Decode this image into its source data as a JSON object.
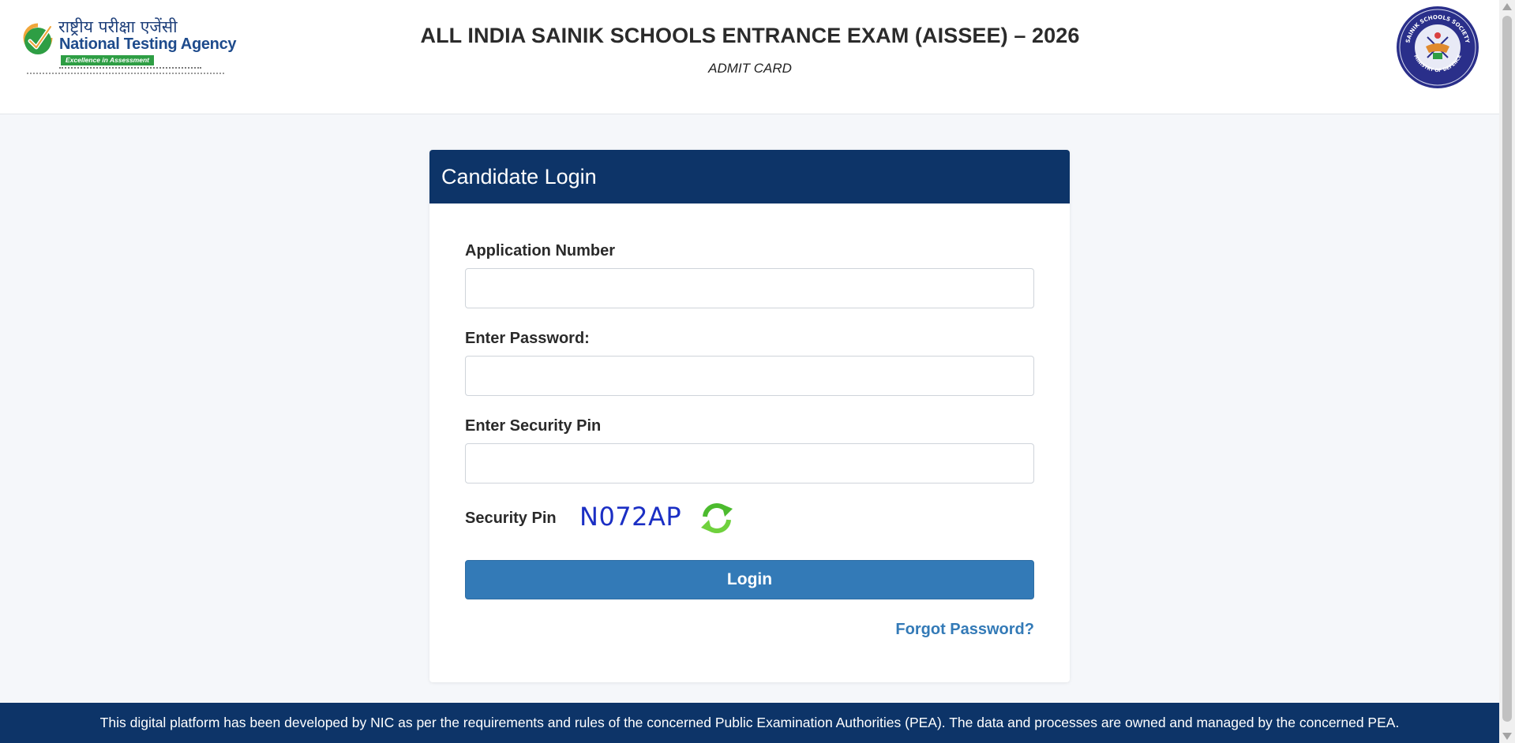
{
  "header": {
    "nta_logo": {
      "hindi": "राष्ट्रीय परीक्षा एजेंसी",
      "name": "National Testing Agency",
      "tagline": "Excellence in Assessment"
    },
    "title": "ALL INDIA SAINIK SCHOOLS ENTRANCE EXAM (AISSEE) – 2026",
    "subtitle": "ADMIT CARD",
    "emblem": {
      "top_text": "SAINIK SCHOOLS SOCIETY",
      "bottom_text": "MINISTRY OF DEFENCE"
    }
  },
  "login": {
    "title": "Candidate Login",
    "application_label": "Application Number",
    "application_value": "",
    "password_label": "Enter Password:",
    "password_value": "",
    "security_pin_input_label": "Enter Security Pin",
    "security_pin_value": "",
    "security_pin_label": "Security Pin",
    "captcha_text": "N072AP",
    "login_button": "Login",
    "forgot_link": "Forgot Password?"
  },
  "footer": {
    "text": "This digital platform has been developed by NIC as per the requirements and rules of the concerned Public Examination Authorities (PEA). The data and processes are owned and managed by the concerned PEA."
  },
  "icons": {
    "nta_check": "check-icon",
    "refresh": "refresh-icon",
    "emblem": "sainik-schools-emblem"
  },
  "colors": {
    "header_bg": "#ffffff",
    "card_header": "#0d3468",
    "footer_bg": "#0d3468",
    "button": "#337ab7",
    "link": "#337ab7",
    "captcha": "#1b2fc4",
    "page_bg": "#f5f7fa"
  }
}
